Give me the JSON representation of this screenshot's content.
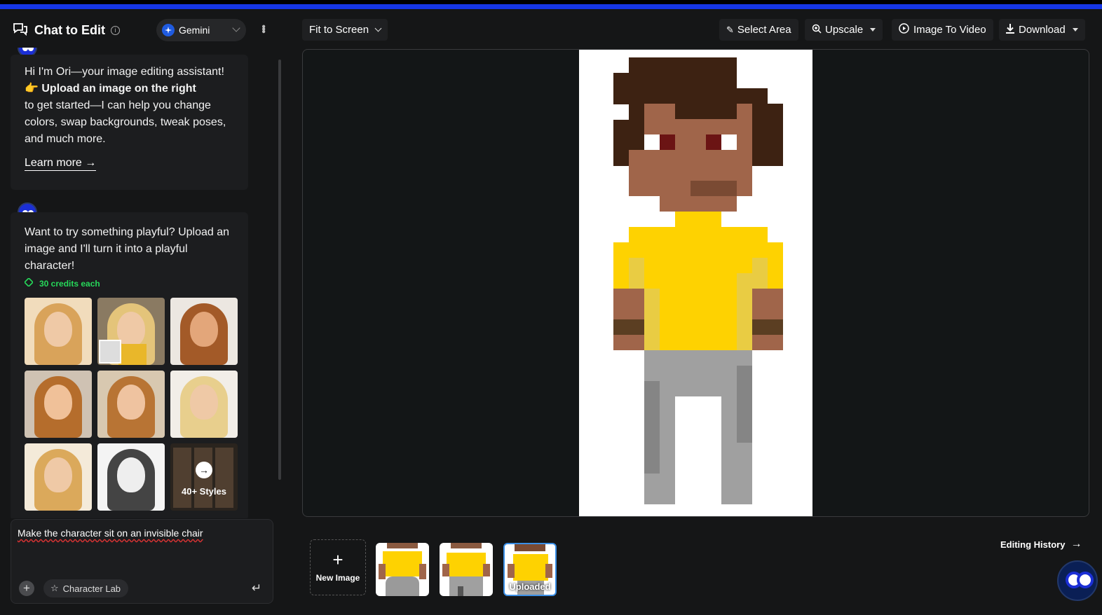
{
  "panel": {
    "title": "Chat to Edit",
    "model": "Gemini",
    "messages": [
      {
        "line1": "Hi I'm Ori—your image editing assistant!",
        "bold": "Upload an image on the right",
        "line2": "to get started—I can help you change colors, swap backgrounds, tweak poses, and much more.",
        "link": "Learn more"
      },
      {
        "text": "Want to try something playful? Upload an image and I'll turn it into a playful character!",
        "credits": "30 credits each",
        "more_styles": "40+ Styles"
      }
    ],
    "input_value": "Make the character sit on an invisible chair",
    "character_lab": "Character Lab"
  },
  "toolbar": {
    "fit": "Fit to Screen",
    "select_area": "Select Area",
    "upscale": "Upscale",
    "image_to_video": "Image To Video",
    "download": "Download"
  },
  "bottom": {
    "new_image": "New Image",
    "uploaded": "Uploaded",
    "editing_history": "Editing History"
  },
  "colors": {
    "accent_bar": "#1636e6",
    "credits_green": "#26d95a",
    "selected_border": "#3b8fe6"
  }
}
